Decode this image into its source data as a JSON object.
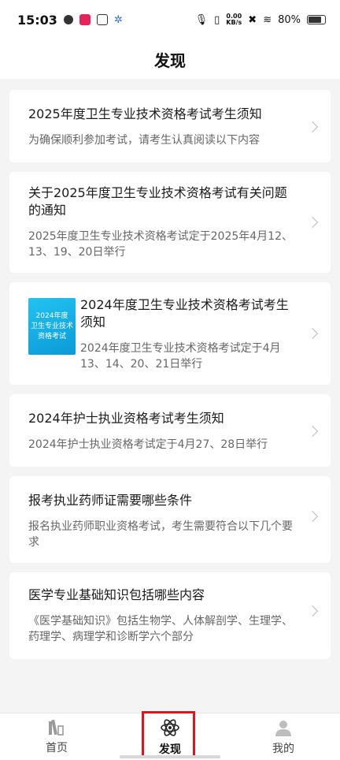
{
  "status_bar": {
    "time": "15:03",
    "speed_top": "0.00",
    "speed_bottom": "KB/s",
    "battery": "80%"
  },
  "header": {
    "title": "发现"
  },
  "articles": [
    {
      "title": "2025年度卫生专业技术资格考试考生须知",
      "desc": "为确保顺利参加考试，请考生认真阅读以下内容"
    },
    {
      "title": "关于2025年度卫生专业技术资格考试有关问题的通知",
      "desc": "2025年度卫生专业技术资格考试定于2025年4月12、13、19、20日举行"
    },
    {
      "title": "2024年度卫生专业技术资格考试考生须知",
      "desc": "2024年度卫生专业技术资格考试定于4月13、14、20、21日举行",
      "thumb_lines": [
        "2024年度",
        "卫生专业技术",
        "资格考试"
      ]
    },
    {
      "title": "2024年护士执业资格考试考生须知",
      "desc": "2024年护士执业资格考试定于4月27、28日举行"
    },
    {
      "title": "报考执业药师证需要哪些条件",
      "desc": "报名执业药师职业资格考试，考生需要符合以下几个要求"
    },
    {
      "title": "医学专业基础知识包括哪些内容",
      "desc": "《医学基础知识》包括生物学、人体解剖学、生理学、药理学、病理学和诊断学六个部分"
    }
  ],
  "tabs": [
    {
      "label": "首页",
      "icon": "home-books-icon"
    },
    {
      "label": "发现",
      "icon": "atom-icon"
    },
    {
      "label": "我的",
      "icon": "user-icon"
    }
  ],
  "colors": {
    "highlight": "#e0141b",
    "thumb": "#0b9ad8"
  }
}
